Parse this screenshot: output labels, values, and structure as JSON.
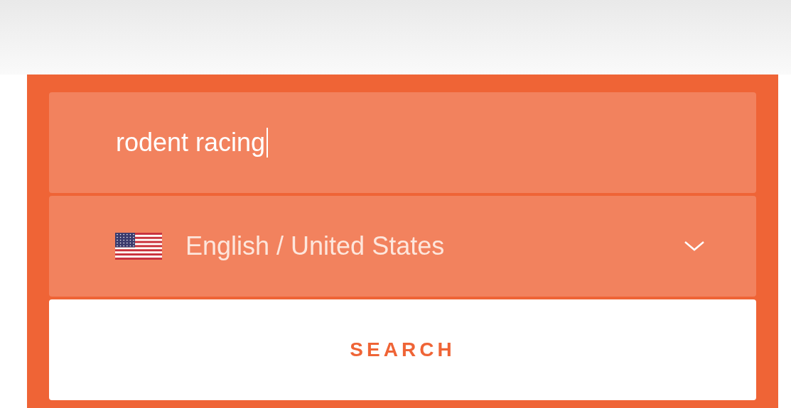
{
  "search_field": {
    "value": "rodent racing",
    "focused": true
  },
  "language_select": {
    "value": "English / United States"
  },
  "search_button": {
    "label": "SEARCH"
  }
}
